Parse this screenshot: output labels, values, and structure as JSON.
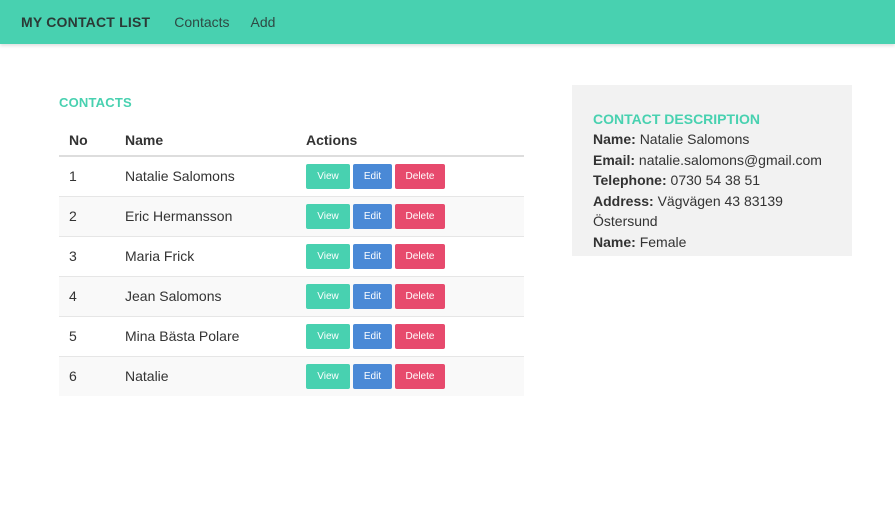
{
  "navbar": {
    "brand": "MY CONTACT LIST",
    "links": [
      "Contacts",
      "Add"
    ],
    "bg_color": "#48d1b0"
  },
  "contacts": {
    "title": "CONTACTS",
    "headers": {
      "no": "No",
      "name": "Name",
      "actions": "Actions"
    },
    "buttons": {
      "view": "View",
      "edit": "Edit",
      "delete": "Delete"
    },
    "rows": [
      {
        "no": "1",
        "name": "Natalie Salomons"
      },
      {
        "no": "2",
        "name": "Eric Hermansson"
      },
      {
        "no": "3",
        "name": "Maria Frick"
      },
      {
        "no": "4",
        "name": "Jean Salomons"
      },
      {
        "no": "5",
        "name": "Mina Bästa Polare"
      },
      {
        "no": "6",
        "name": "Natalie"
      }
    ]
  },
  "description": {
    "title": "CONTACT DESCRIPTION",
    "name_label": "Name:",
    "name_value": "Natalie Salomons",
    "email_label": "Email:",
    "email_value": "natalie.salomons@gmail.com",
    "telephone_label": "Telephone:",
    "telephone_value": "0730 54 38 51",
    "address_label": "Address:",
    "address_value": "Vägvägen 43 83139 Östersund",
    "gender_label": "Name:",
    "gender_value": "Female"
  },
  "colors": {
    "accent": "#48d1b0",
    "view": "#48d1b0",
    "edit": "#4a89d6",
    "delete": "#e74a6d"
  }
}
